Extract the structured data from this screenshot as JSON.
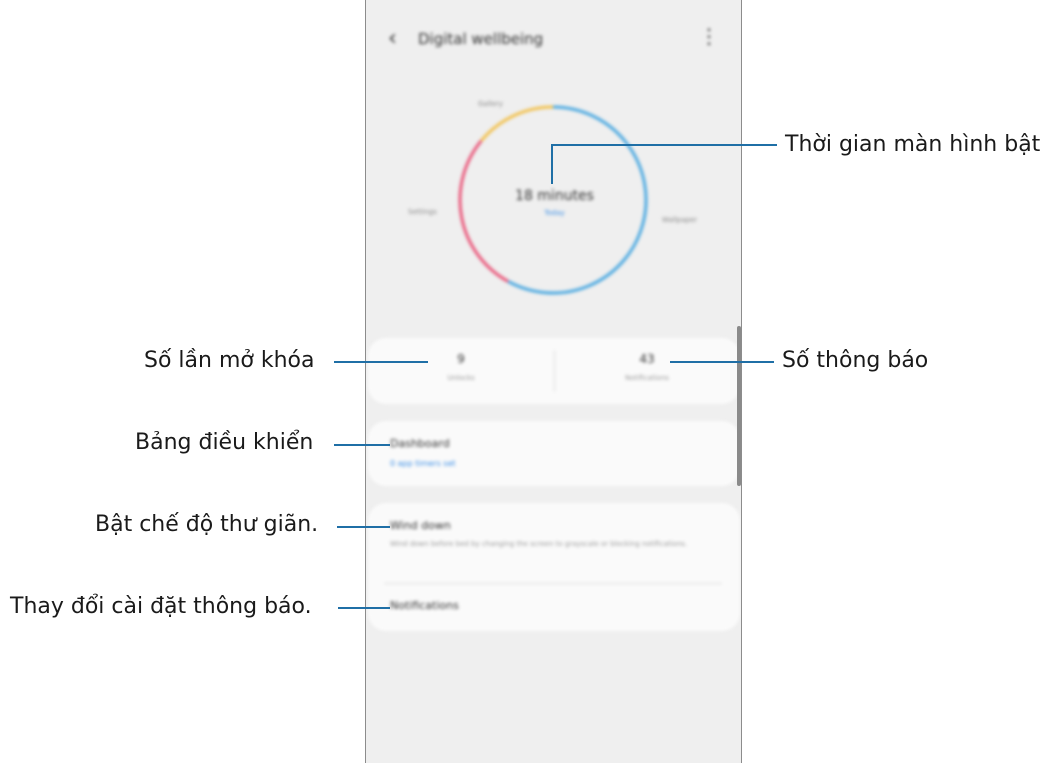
{
  "app": {
    "title": "Digital wellbeing",
    "back_icon": "chevron-left-icon",
    "menu_icon": "more-vertical-icon"
  },
  "chart": {
    "center_value": "18 minutes",
    "center_sub": "Today",
    "labels": {
      "top": "Gallery",
      "left": "Settings",
      "right": "Wallpaper"
    }
  },
  "chart_data": {
    "type": "pie",
    "categories": [
      "Wallpaper",
      "Settings",
      "Gallery"
    ],
    "values": [
      58,
      28,
      14
    ],
    "colors": [
      "#4aa8e0",
      "#e9577a",
      "#f2c14e"
    ]
  },
  "stats": {
    "unlocks_value": "9",
    "unlocks_label": "Unlocks",
    "notifications_value": "43",
    "notifications_label": "Notifications"
  },
  "dashboard": {
    "title": "Dashboard",
    "subtitle": "0 app timers set"
  },
  "wind_down": {
    "title": "Wind down",
    "description": "Wind down before bed by changing the screen to grayscale or blocking notifications."
  },
  "notifications_item": {
    "title": "Notifications"
  },
  "callouts": {
    "screen_time": "Thời gian màn hình bật",
    "unlocks": "Số lần mở khóa",
    "notifications": "Số thông báo",
    "dashboard": "Bảng điều khiển",
    "wind_down": "Bật chế độ thư giãn.",
    "change_notifications": "Thay đổi cài đặt thông báo."
  },
  "colors": {
    "accent": "#1f6fa6",
    "link": "#3a8ee6"
  }
}
